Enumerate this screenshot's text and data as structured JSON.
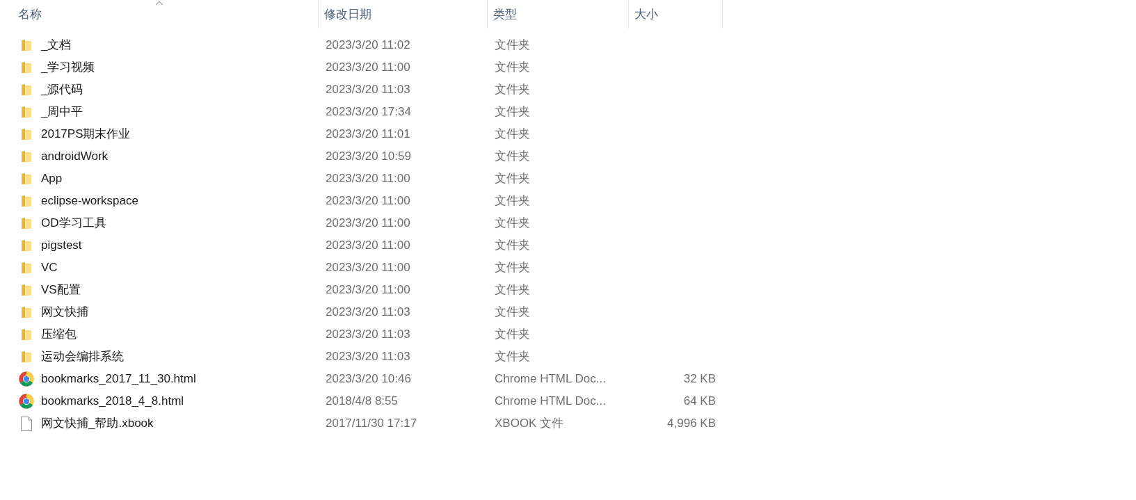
{
  "columns": [
    {
      "label": "名称",
      "sorted": true
    },
    {
      "label": "修改日期",
      "sorted": false
    },
    {
      "label": "类型",
      "sorted": false
    },
    {
      "label": "大小",
      "sorted": false
    }
  ],
  "rows": [
    {
      "kind": "folder",
      "name": "_文档",
      "date": "2023/3/20 11:02",
      "type": "文件夹"
    },
    {
      "kind": "folder",
      "name": "_学习视频",
      "date": "2023/3/20 11:00",
      "type": "文件夹"
    },
    {
      "kind": "folder",
      "name": "_源代码",
      "date": "2023/3/20 11:03",
      "type": "文件夹"
    },
    {
      "kind": "folder",
      "name": "_周中平",
      "date": "2023/3/20 17:34",
      "type": "文件夹"
    },
    {
      "kind": "folder",
      "name": "2017PS期末作业",
      "date": "2023/3/20 11:01",
      "type": "文件夹"
    },
    {
      "kind": "folder",
      "name": "androidWork",
      "date": "2023/3/20 10:59",
      "type": "文件夹"
    },
    {
      "kind": "folder",
      "name": "App",
      "date": "2023/3/20 11:00",
      "type": "文件夹"
    },
    {
      "kind": "folder",
      "name": "eclipse-workspace",
      "date": "2023/3/20 11:00",
      "type": "文件夹"
    },
    {
      "kind": "folder",
      "name": "OD学习工具",
      "date": "2023/3/20 11:00",
      "type": "文件夹"
    },
    {
      "kind": "folder",
      "name": "pigstest",
      "date": "2023/3/20 11:00",
      "type": "文件夹"
    },
    {
      "kind": "folder",
      "name": "VC",
      "date": "2023/3/20 11:00",
      "type": "文件夹"
    },
    {
      "kind": "folder",
      "name": "VS配置",
      "date": "2023/3/20 11:00",
      "type": "文件夹"
    },
    {
      "kind": "folder",
      "name": "网文快捕",
      "date": "2023/3/20 11:03",
      "type": "文件夹"
    },
    {
      "kind": "folder",
      "name": "压缩包",
      "date": "2023/3/20 11:03",
      "type": "文件夹"
    },
    {
      "kind": "folder",
      "name": "运动会编排系统",
      "date": "2023/3/20 11:03",
      "type": "文件夹"
    },
    {
      "kind": "chrome",
      "name": "bookmarks_2017_11_30.html",
      "date": "2023/3/20 10:46",
      "type": "Chrome HTML Doc...",
      "size": "32 KB"
    },
    {
      "kind": "chrome",
      "name": "bookmarks_2018_4_8.html",
      "date": "2018/4/8 8:55",
      "type": "Chrome HTML Doc...",
      "size": "64 KB"
    },
    {
      "kind": "file",
      "name": "网文快捕_帮助.xbook",
      "date": "2017/11/30 17:17",
      "type": "XBOOK 文件",
      "size": "4,996 KB"
    }
  ]
}
